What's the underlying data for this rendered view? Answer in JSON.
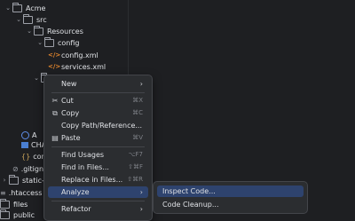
{
  "tree": [
    {
      "label": "Acme",
      "kind": "folder"
    },
    {
      "label": "src",
      "kind": "folder"
    },
    {
      "label": "Resources",
      "kind": "folder"
    },
    {
      "label": "config",
      "kind": "folder"
    },
    {
      "label": "config.xml",
      "kind": "xml"
    },
    {
      "label": "services.xml",
      "kind": "xml"
    },
    {
      "label": "A",
      "kind": "partial"
    },
    {
      "label": "CHA",
      "kind": "partial"
    },
    {
      "label": "con",
      "kind": "partial"
    },
    {
      "label": ".gitign",
      "kind": "partial"
    },
    {
      "label": "static-plug",
      "kind": "folder"
    },
    {
      "label": ".htaccess",
      "kind": "file"
    },
    {
      "label": "files",
      "kind": "folder"
    },
    {
      "label": "public",
      "kind": "folder"
    }
  ],
  "menu": {
    "items": [
      {
        "label": "New",
        "shortcut": "",
        "submenu": true
      },
      {
        "label": "Cut",
        "shortcut": "⌘X",
        "icon": "scissors-icon"
      },
      {
        "label": "Copy",
        "shortcut": "⌘C",
        "icon": "copy-icon"
      },
      {
        "label": "Copy Path/Reference...",
        "shortcut": ""
      },
      {
        "label": "Paste",
        "shortcut": "⌘V",
        "icon": "paste-icon"
      },
      {
        "label": "Find Usages",
        "shortcut": "⌥F7"
      },
      {
        "label": "Find in Files...",
        "shortcut": "⇧⌘F"
      },
      {
        "label": "Replace in Files...",
        "shortcut": "⇧⌘R"
      },
      {
        "label": "Analyze",
        "shortcut": "",
        "submenu": true
      },
      {
        "label": "Refactor",
        "shortcut": "",
        "submenu": true
      }
    ]
  },
  "submenu": {
    "items": [
      {
        "label": "Inspect Code..."
      },
      {
        "label": "Code Cleanup..."
      }
    ]
  }
}
